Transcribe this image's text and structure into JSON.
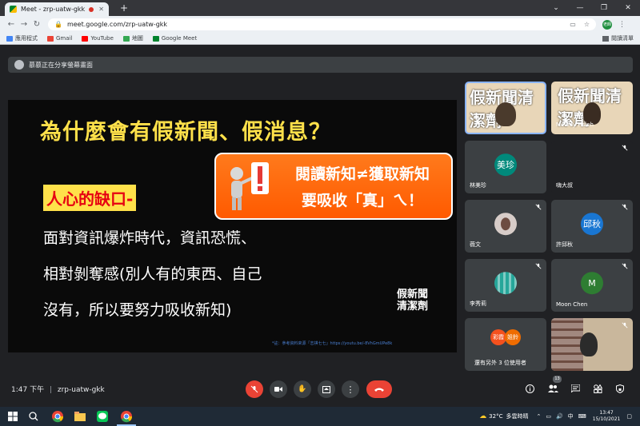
{
  "browser": {
    "tab_title": "Meet - zrp-uatw-gkk",
    "url": "meet.google.com/zrp-uatw-gkk",
    "profile_initials": "老師",
    "bookmarks": [
      "應用程式",
      "Gmail",
      "YouTube",
      "地圖",
      "Google Meet"
    ],
    "reading_list": "閱讀清單"
  },
  "presenter": {
    "text": "慕慕正在分享螢幕畫面"
  },
  "slide": {
    "title": "為什麼會有假新聞、假消息？",
    "highlight": "人心的缺口-",
    "callout_line1": "閱讀新知≠獲取新知",
    "callout_line2": "要吸收「真」ㄟ！",
    "lines": [
      "面對資訊爆炸時代，資訊恐慌、",
      "相對剝奪感(別人有的東西、自己",
      "沒有，所以要努力吸收新知)"
    ],
    "logo_line1": "假新聞",
    "logo_line2": "清潔劑",
    "reference": "*註：參考資料來源「志祺七七」https://youtu.be/-8VhGmUPe8k"
  },
  "participants": [
    {
      "name": "",
      "type": "video",
      "overlay": "假新聞清潔劑"
    },
    {
      "name": "Melody Hsieh",
      "type": "video",
      "overlay": "假新聞清潔劑"
    },
    {
      "name": "林美珍",
      "type": "avatar",
      "initials": "美珍",
      "color": "#00897b"
    },
    {
      "name": "嗨大叔",
      "type": "blank"
    },
    {
      "name": "薇文",
      "type": "photo"
    },
    {
      "name": "許邱秋",
      "type": "avatar",
      "initials": "邱秋",
      "color": "#1976d2"
    },
    {
      "name": "李秀莉",
      "type": "photo"
    },
    {
      "name": "Moon Chen",
      "type": "avatar",
      "initials": "M",
      "color": "#2e7d32"
    },
    {
      "name": "還有另外 3 位使用者",
      "type": "group",
      "initials": [
        "彩霞",
        "姐鈴"
      ]
    },
    {
      "name": "",
      "type": "video"
    }
  ],
  "bottombar": {
    "time": "1:47 下午",
    "meeting_code": "zrp-uatw-gkk",
    "participant_count": "13"
  },
  "taskbar": {
    "temperature": "32°C",
    "weather": "多雲時晴",
    "ime": "中",
    "time": "13:47",
    "date": "15/10/2021"
  },
  "colors": {
    "meet_bg": "#202124",
    "tile_bg": "#3c4043",
    "slide_title": "#ffe14a",
    "callout": "#ff6a00",
    "hangup": "#ea4335"
  }
}
